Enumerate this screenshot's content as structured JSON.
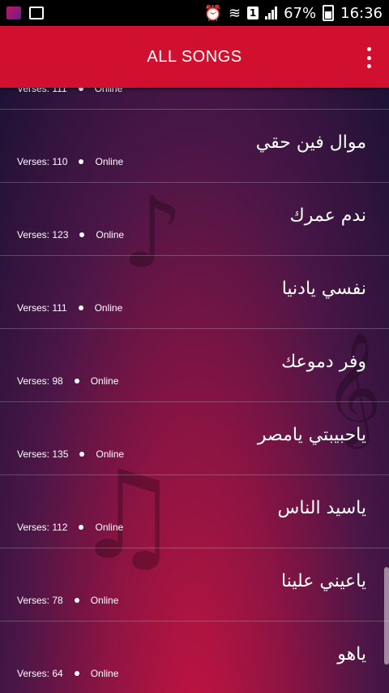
{
  "status_bar": {
    "battery": "67%",
    "time": "16:36",
    "sim": "1"
  },
  "toolbar": {
    "title": "ALL SONGS",
    "menu_icon": "overflow-menu-icon"
  },
  "songs": [
    {
      "title": "",
      "verses_label": "Verses: 111",
      "status": "Online"
    },
    {
      "title": "موال فين حقي",
      "verses_label": "Verses: 110",
      "status": "Online"
    },
    {
      "title": "ندم عمرك",
      "verses_label": "Verses: 123",
      "status": "Online"
    },
    {
      "title": "نفسي يادنيا",
      "verses_label": "Verses: 111",
      "status": "Online"
    },
    {
      "title": "وفر دموعك",
      "verses_label": "Verses: 98",
      "status": "Online"
    },
    {
      "title": "ياحبيبتي يامصر",
      "verses_label": "Verses: 135",
      "status": "Online"
    },
    {
      "title": "ياسيد الناس",
      "verses_label": "Verses: 112",
      "status": "Online"
    },
    {
      "title": "ياعيني علينا",
      "verses_label": "Verses: 78",
      "status": "Online"
    },
    {
      "title": "ياهو",
      "verses_label": "Verses: 64",
      "status": "Online"
    }
  ]
}
